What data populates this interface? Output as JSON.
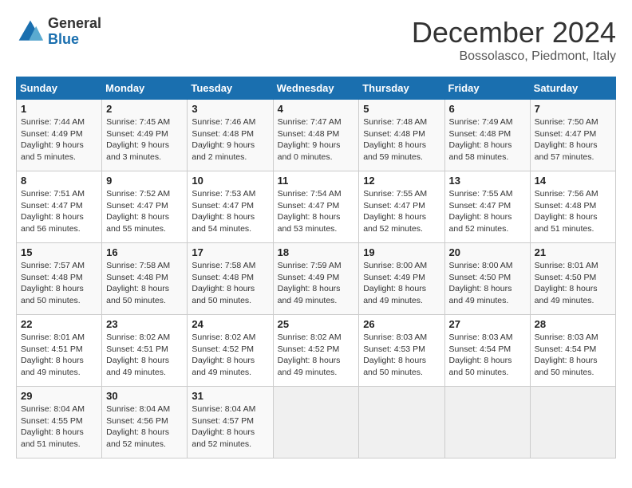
{
  "logo": {
    "line1": "General",
    "line2": "Blue"
  },
  "title": "December 2024",
  "location": "Bossolasco, Piedmont, Italy",
  "weekdays": [
    "Sunday",
    "Monday",
    "Tuesday",
    "Wednesday",
    "Thursday",
    "Friday",
    "Saturday"
  ],
  "weeks": [
    [
      {
        "day": "1",
        "sunrise": "7:44 AM",
        "sunset": "4:49 PM",
        "daylight": "9 hours and 5 minutes."
      },
      {
        "day": "2",
        "sunrise": "7:45 AM",
        "sunset": "4:49 PM",
        "daylight": "9 hours and 3 minutes."
      },
      {
        "day": "3",
        "sunrise": "7:46 AM",
        "sunset": "4:48 PM",
        "daylight": "9 hours and 2 minutes."
      },
      {
        "day": "4",
        "sunrise": "7:47 AM",
        "sunset": "4:48 PM",
        "daylight": "9 hours and 0 minutes."
      },
      {
        "day": "5",
        "sunrise": "7:48 AM",
        "sunset": "4:48 PM",
        "daylight": "8 hours and 59 minutes."
      },
      {
        "day": "6",
        "sunrise": "7:49 AM",
        "sunset": "4:48 PM",
        "daylight": "8 hours and 58 minutes."
      },
      {
        "day": "7",
        "sunrise": "7:50 AM",
        "sunset": "4:47 PM",
        "daylight": "8 hours and 57 minutes."
      }
    ],
    [
      {
        "day": "8",
        "sunrise": "7:51 AM",
        "sunset": "4:47 PM",
        "daylight": "8 hours and 56 minutes."
      },
      {
        "day": "9",
        "sunrise": "7:52 AM",
        "sunset": "4:47 PM",
        "daylight": "8 hours and 55 minutes."
      },
      {
        "day": "10",
        "sunrise": "7:53 AM",
        "sunset": "4:47 PM",
        "daylight": "8 hours and 54 minutes."
      },
      {
        "day": "11",
        "sunrise": "7:54 AM",
        "sunset": "4:47 PM",
        "daylight": "8 hours and 53 minutes."
      },
      {
        "day": "12",
        "sunrise": "7:55 AM",
        "sunset": "4:47 PM",
        "daylight": "8 hours and 52 minutes."
      },
      {
        "day": "13",
        "sunrise": "7:55 AM",
        "sunset": "4:47 PM",
        "daylight": "8 hours and 52 minutes."
      },
      {
        "day": "14",
        "sunrise": "7:56 AM",
        "sunset": "4:48 PM",
        "daylight": "8 hours and 51 minutes."
      }
    ],
    [
      {
        "day": "15",
        "sunrise": "7:57 AM",
        "sunset": "4:48 PM",
        "daylight": "8 hours and 50 minutes."
      },
      {
        "day": "16",
        "sunrise": "7:58 AM",
        "sunset": "4:48 PM",
        "daylight": "8 hours and 50 minutes."
      },
      {
        "day": "17",
        "sunrise": "7:58 AM",
        "sunset": "4:48 PM",
        "daylight": "8 hours and 50 minutes."
      },
      {
        "day": "18",
        "sunrise": "7:59 AM",
        "sunset": "4:49 PM",
        "daylight": "8 hours and 49 minutes."
      },
      {
        "day": "19",
        "sunrise": "8:00 AM",
        "sunset": "4:49 PM",
        "daylight": "8 hours and 49 minutes."
      },
      {
        "day": "20",
        "sunrise": "8:00 AM",
        "sunset": "4:50 PM",
        "daylight": "8 hours and 49 minutes."
      },
      {
        "day": "21",
        "sunrise": "8:01 AM",
        "sunset": "4:50 PM",
        "daylight": "8 hours and 49 minutes."
      }
    ],
    [
      {
        "day": "22",
        "sunrise": "8:01 AM",
        "sunset": "4:51 PM",
        "daylight": "8 hours and 49 minutes."
      },
      {
        "day": "23",
        "sunrise": "8:02 AM",
        "sunset": "4:51 PM",
        "daylight": "8 hours and 49 minutes."
      },
      {
        "day": "24",
        "sunrise": "8:02 AM",
        "sunset": "4:52 PM",
        "daylight": "8 hours and 49 minutes."
      },
      {
        "day": "25",
        "sunrise": "8:02 AM",
        "sunset": "4:52 PM",
        "daylight": "8 hours and 49 minutes."
      },
      {
        "day": "26",
        "sunrise": "8:03 AM",
        "sunset": "4:53 PM",
        "daylight": "8 hours and 50 minutes."
      },
      {
        "day": "27",
        "sunrise": "8:03 AM",
        "sunset": "4:54 PM",
        "daylight": "8 hours and 50 minutes."
      },
      {
        "day": "28",
        "sunrise": "8:03 AM",
        "sunset": "4:54 PM",
        "daylight": "8 hours and 50 minutes."
      }
    ],
    [
      {
        "day": "29",
        "sunrise": "8:04 AM",
        "sunset": "4:55 PM",
        "daylight": "8 hours and 51 minutes."
      },
      {
        "day": "30",
        "sunrise": "8:04 AM",
        "sunset": "4:56 PM",
        "daylight": "8 hours and 52 minutes."
      },
      {
        "day": "31",
        "sunrise": "8:04 AM",
        "sunset": "4:57 PM",
        "daylight": "8 hours and 52 minutes."
      },
      null,
      null,
      null,
      null
    ]
  ]
}
